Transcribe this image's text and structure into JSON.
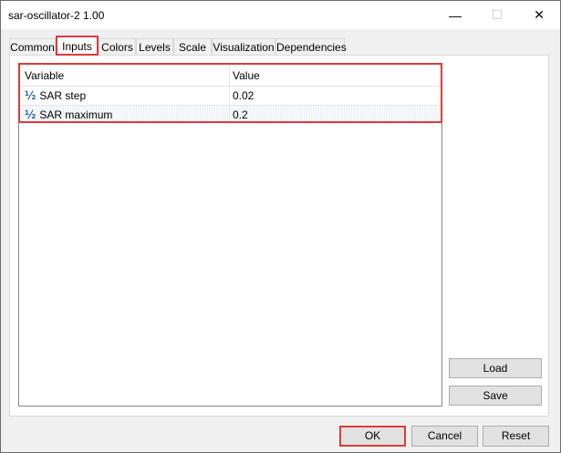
{
  "window": {
    "title": "sar-oscillator-2 1.00",
    "minimize_glyph": "—",
    "maximize_glyph": "☐",
    "close_glyph": "✕"
  },
  "tabs": [
    {
      "label": "Common"
    },
    {
      "label": "Inputs",
      "active": true
    },
    {
      "label": "Colors"
    },
    {
      "label": "Levels"
    },
    {
      "label": "Scale"
    },
    {
      "label": "Visualization"
    },
    {
      "label": "Dependencies"
    }
  ],
  "grid": {
    "headers": {
      "variable": "Variable",
      "value": "Value"
    },
    "rows": [
      {
        "icon": "half-fraction-icon",
        "icon_glyph": "½",
        "variable": "SAR step",
        "value": "0.02"
      },
      {
        "icon": "half-fraction-icon",
        "icon_glyph": "½",
        "variable": "SAR maximum",
        "value": "0.2"
      }
    ]
  },
  "side_buttons": {
    "load": "Load",
    "save": "Save"
  },
  "footer": {
    "ok": "OK",
    "cancel": "Cancel",
    "reset": "Reset"
  },
  "colors": {
    "highlight": "#e03a3a",
    "icon": "#2a5fb0"
  }
}
